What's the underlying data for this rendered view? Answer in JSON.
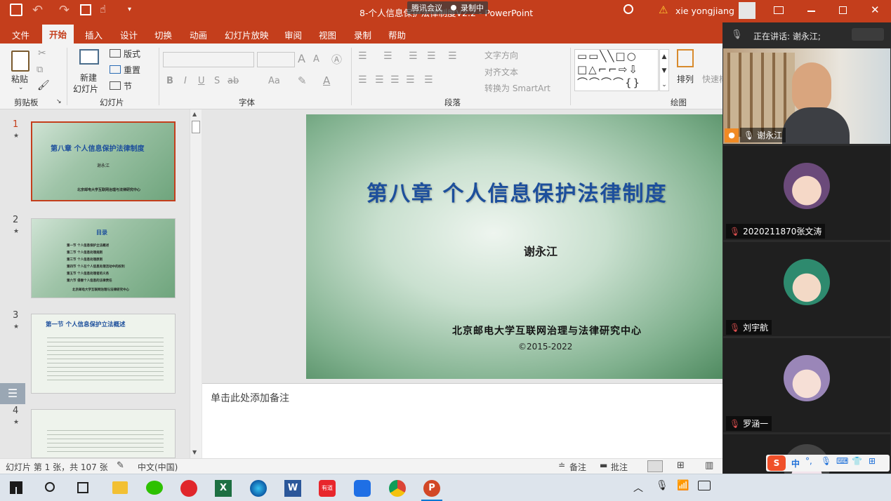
{
  "titlebar": {
    "doc_title": "8-个人信息保护法律制度V2.2 - PowerPoint",
    "meeting_badge": "腾讯会议",
    "recording_badge": "录制中",
    "user_name": "xie yongjiang",
    "warning_icon": "warning-icon"
  },
  "tabs": [
    "文件",
    "开始",
    "插入",
    "设计",
    "切换",
    "动画",
    "幻灯片放映",
    "审阅",
    "视图",
    "录制",
    "帮助"
  ],
  "ribbon": {
    "clipboard": {
      "paste": "粘贴",
      "label": "剪贴板"
    },
    "slides": {
      "new_slide_1": "新建",
      "new_slide_2": "幻灯片",
      "layout": "版式",
      "reset": "重置",
      "section": "节",
      "label": "幻灯片"
    },
    "font": {
      "label": "字体",
      "bold": "B",
      "italic": "I",
      "underline": "U",
      "strike": "S",
      "abc": "ab",
      "aa": "Aa",
      "grow": "A",
      "shrink": "A"
    },
    "paragraph": {
      "label": "段落",
      "text_direction": "文字方向",
      "align_text": "对齐文本",
      "smartart": "转换为 SmartArt"
    },
    "drawing": {
      "label": "绘图",
      "arrange": "排列",
      "quick_styles": "快速样"
    }
  },
  "thumbnails": [
    {
      "num": "1",
      "title": "第八章 个人信息保护法律制度",
      "author": "谢永江",
      "org": "北京邮电大学互联网治理与法律研究中心"
    },
    {
      "num": "2",
      "title": "目录",
      "items": [
        "第一节 个人信息保护立法概述",
        "第二节 个人信息处理规则",
        "第三节 个人信息处理原则",
        "第四节 个人在个人信息处理活动中的权利",
        "第五节 个人信息处理者的义务",
        "第六节 侵害个人信息的法律责任"
      ],
      "org": "北京邮电大学互联网治理与法律研究中心"
    },
    {
      "num": "3",
      "title": "第一节 个人信息保护立法概述"
    },
    {
      "num": "4"
    }
  ],
  "slide": {
    "title": "第八章  个人信息保护法律制度",
    "author": "谢永江",
    "org": "北京邮电大学互联网治理与法律研究中心",
    "copyright": "©2015-2022"
  },
  "notes_placeholder": "单击此处添加备注",
  "status": {
    "slide_count": "幻灯片 第 1 张，共 107 张",
    "language": "中文(中国)",
    "notes": "备注",
    "comments": "批注"
  },
  "meeting": {
    "speaking": "正在讲话: 谢永江;",
    "participants": [
      {
        "name": "谢永江"
      },
      {
        "name": "2020211870张文涛"
      },
      {
        "name": "刘宇航"
      },
      {
        "name": "罗涵一"
      }
    ]
  },
  "ime": {
    "lang": "中"
  },
  "taskbar_apps": [
    "search-icon",
    "task-view-icon",
    "file-explorer-icon",
    "wechat-icon",
    "netease-music-icon",
    "excel-icon",
    "edge-icon",
    "word-icon",
    "youdao-icon",
    "tencent-meeting-icon",
    "chrome-icon",
    "powerpoint-icon"
  ],
  "taskbar": {
    "excel": "X",
    "word": "W",
    "youdao": "有道",
    "ppt": "P"
  },
  "colors": {
    "accent": "#c43e1c",
    "slide_title": "#1d4f9c",
    "meeting_bg": "#2b2b2b"
  }
}
